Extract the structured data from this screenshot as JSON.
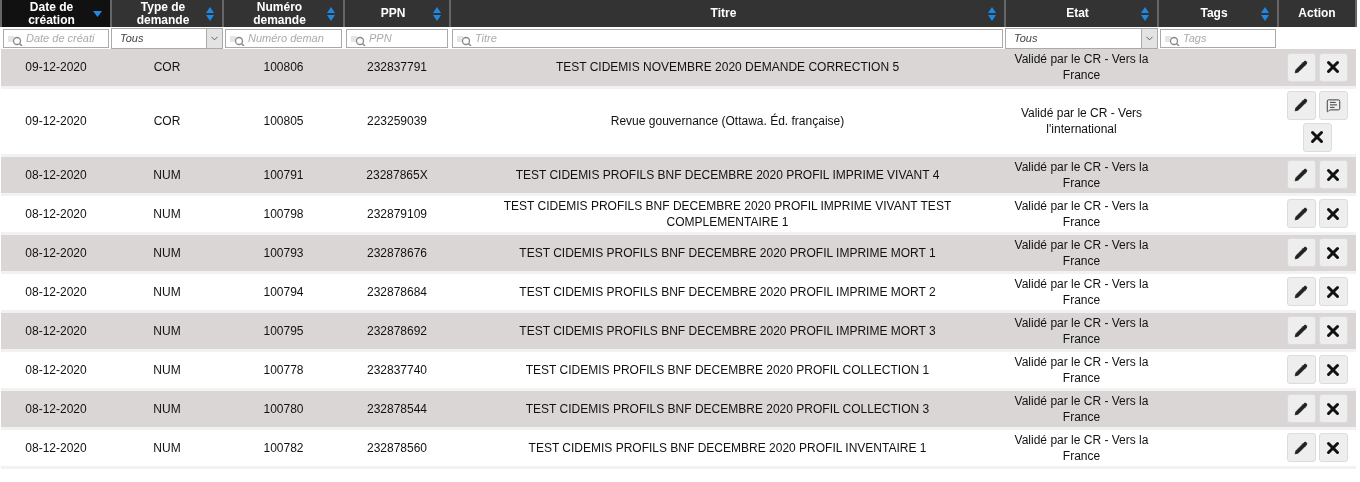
{
  "columns": [
    {
      "label": "Date de création",
      "sortable": true,
      "sorted": true,
      "filter": {
        "kind": "text",
        "placeholder": "Date de créati"
      }
    },
    {
      "label": "Type de demande",
      "sortable": true,
      "sorted": false,
      "filter": {
        "kind": "select",
        "value": "Tous"
      }
    },
    {
      "label": "Numéro demande",
      "sortable": true,
      "sorted": false,
      "filter": {
        "kind": "text",
        "placeholder": "Numéro deman"
      }
    },
    {
      "label": "PPN",
      "sortable": true,
      "sorted": false,
      "filter": {
        "kind": "text",
        "placeholder": "PPN"
      }
    },
    {
      "label": "Titre",
      "sortable": true,
      "sorted": false,
      "filter": {
        "kind": "text",
        "placeholder": "Titre"
      }
    },
    {
      "label": "Etat",
      "sortable": true,
      "sorted": false,
      "filter": {
        "kind": "select",
        "value": "Tous"
      }
    },
    {
      "label": "Tags",
      "sortable": true,
      "sorted": false,
      "filter": {
        "kind": "text",
        "placeholder": "Tags"
      }
    },
    {
      "label": "Action",
      "sortable": false,
      "sorted": false
    }
  ],
  "rows": [
    {
      "cells": [
        "09-12-2020",
        "COR",
        "100806",
        "232837791",
        "TEST CIDEMIS NOVEMBRE 2020 DEMANDE CORRECTION 5",
        "Validé par le CR - Vers la France"
      ],
      "actions": [
        {
          "kind": "edit"
        },
        {
          "kind": "delete"
        }
      ]
    },
    {
      "cells": [
        "09-12-2020",
        "COR",
        "100805",
        "223259039",
        "Revue gouvernance (Ottawa. Éd. française)",
        "Validé par le CR - Vers l'international"
      ],
      "actions": [
        {
          "kind": "edit"
        },
        {
          "kind": "comment"
        },
        {
          "kind": "delete"
        }
      ]
    },
    {
      "cells": [
        "08-12-2020",
        "NUM",
        "100791",
        "23287865X",
        "TEST CIDEMIS PROFILS BNF DECEMBRE 2020 PROFIL IMPRIME VIVANT 4",
        "Validé par le CR - Vers la France"
      ],
      "actions": [
        {
          "kind": "edit"
        },
        {
          "kind": "delete"
        }
      ]
    },
    {
      "cells": [
        "08-12-2020",
        "NUM",
        "100798",
        "232879109",
        "TEST CIDEMIS PROFILS BNF DECEMBRE 2020 PROFIL IMPRIME VIVANT TEST COMPLEMENTAIRE 1",
        "Validé par le CR - Vers la France"
      ],
      "actions": [
        {
          "kind": "edit"
        },
        {
          "kind": "delete"
        }
      ]
    },
    {
      "cells": [
        "08-12-2020",
        "NUM",
        "100793",
        "232878676",
        "TEST CIDEMIS PROFILS BNF DECEMBRE 2020 PROFIL IMPRIME MORT 1",
        "Validé par le CR - Vers la France"
      ],
      "actions": [
        {
          "kind": "edit"
        },
        {
          "kind": "delete"
        }
      ]
    },
    {
      "cells": [
        "08-12-2020",
        "NUM",
        "100794",
        "232878684",
        "TEST CIDEMIS PROFILS BNF DECEMBRE 2020 PROFIL IMPRIME MORT 2",
        "Validé par le CR - Vers la France"
      ],
      "actions": [
        {
          "kind": "edit"
        },
        {
          "kind": "delete"
        }
      ]
    },
    {
      "cells": [
        "08-12-2020",
        "NUM",
        "100795",
        "232878692",
        "TEST CIDEMIS PROFILS BNF DECEMBRE 2020 PROFIL IMPRIME MORT 3",
        "Validé par le CR - Vers la France"
      ],
      "actions": [
        {
          "kind": "edit"
        },
        {
          "kind": "delete"
        }
      ]
    },
    {
      "cells": [
        "08-12-2020",
        "NUM",
        "100778",
        "232837740",
        "TEST CIDEMIS PROFILS BNF DECEMBRE 2020 PROFIL COLLECTION 1",
        "Validé par le CR - Vers la France"
      ],
      "actions": [
        {
          "kind": "edit"
        },
        {
          "kind": "delete"
        }
      ]
    },
    {
      "cells": [
        "08-12-2020",
        "NUM",
        "100780",
        "232878544",
        "TEST CIDEMIS PROFILS BNF DECEMBRE 2020 PROFIL COLLECTION 3",
        "Validé par le CR - Vers la France"
      ],
      "actions": [
        {
          "kind": "edit"
        },
        {
          "kind": "delete"
        }
      ]
    },
    {
      "cells": [
        "08-12-2020",
        "NUM",
        "100782",
        "232878560",
        "TEST CIDEMIS PROFILS BNF DECEMBRE 2020 PROFIL INVENTAIRE 1",
        "Validé par le CR - Vers la France"
      ],
      "actions": [
        {
          "kind": "edit"
        },
        {
          "kind": "delete"
        }
      ]
    }
  ]
}
